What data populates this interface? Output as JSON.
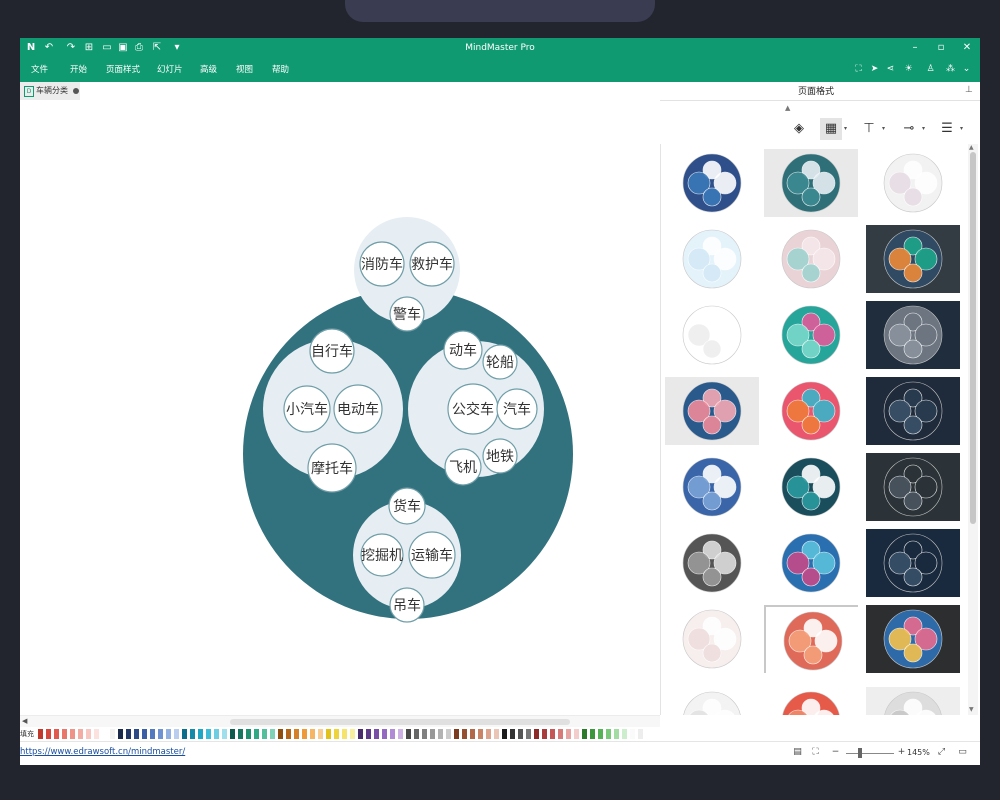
{
  "app": {
    "title": "MindMaster Pro"
  },
  "quick_access": {
    "logo": "mindmaster-logo",
    "icons": [
      "undo-icon",
      "redo-icon",
      "new-file-icon",
      "open-folder-icon",
      "save-icon",
      "print-icon",
      "export-icon",
      "dropdown-icon"
    ]
  },
  "menu": [
    "文件",
    "开始",
    "页面样式",
    "幻灯片",
    "高级",
    "视图",
    "帮助"
  ],
  "document": {
    "tab_label": "车辆分类"
  },
  "panel": {
    "title": "页面格式"
  },
  "diagram": {
    "groups": [
      {
        "items": [
          "消防车",
          "救护车",
          "警车"
        ]
      },
      {
        "items": [
          "自行车",
          "小汽车",
          "电动车",
          "摩托车"
        ]
      },
      {
        "items": [
          "动车",
          "轮船",
          "公交车",
          "汽车",
          "地铁",
          "飞机"
        ]
      },
      {
        "items": [
          "货车",
          "挖掘机",
          "运输车",
          "吊车"
        ]
      }
    ]
  },
  "status": {
    "url": "https://www.edrawsoft.cn/mindmaster/",
    "zoom": "145%",
    "zoom_plus": "+",
    "zoom_minus": "−"
  },
  "palette": {
    "fill_label": "填充"
  },
  "colors": {
    "brand": "#109a72",
    "diagram_outer": "#32727e",
    "bubble_fill": "#e6eef3",
    "leaf_fill": "#ffffff",
    "leaf_stroke": "#6f9ea8"
  }
}
